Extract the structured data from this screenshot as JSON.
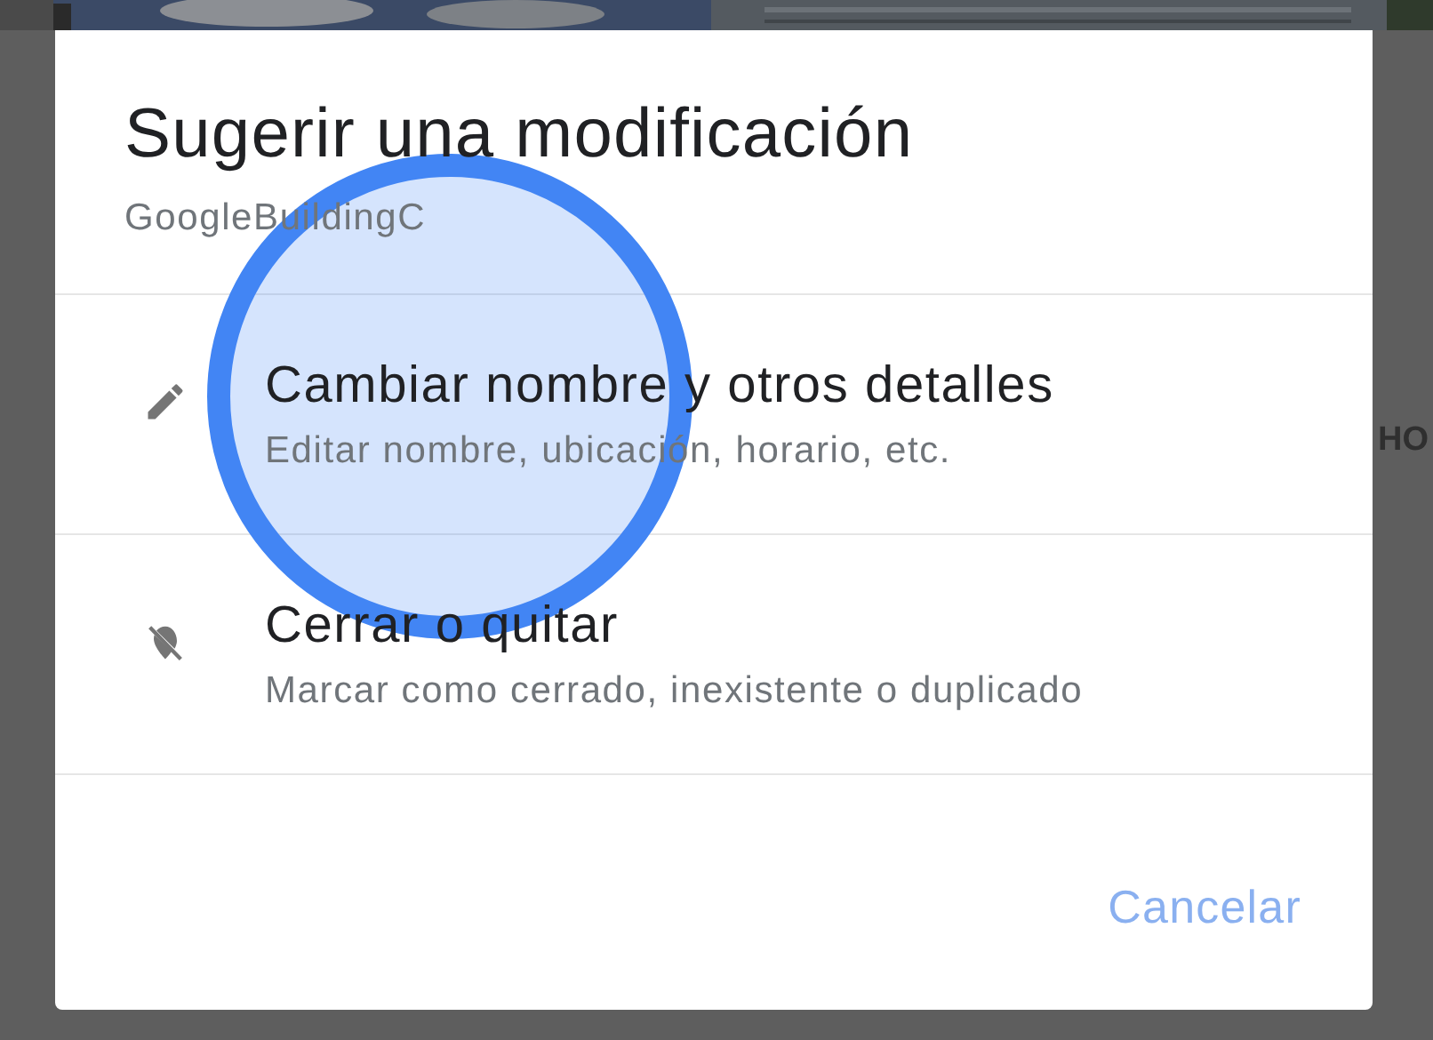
{
  "background": {
    "side_text": "HO"
  },
  "dialog": {
    "title": "Sugerir una modificación",
    "subtitle": "GoogleBuildingC",
    "options": [
      {
        "kind": "edit",
        "title": "Cambiar nombre y otros detalles",
        "description": "Editar nombre, ubicación, horario, etc."
      },
      {
        "kind": "close",
        "title": "Cerrar o quitar",
        "description": "Marcar como cerrado, inexistente o duplicado"
      }
    ],
    "buttons": [
      "Cancelar"
    ]
  }
}
